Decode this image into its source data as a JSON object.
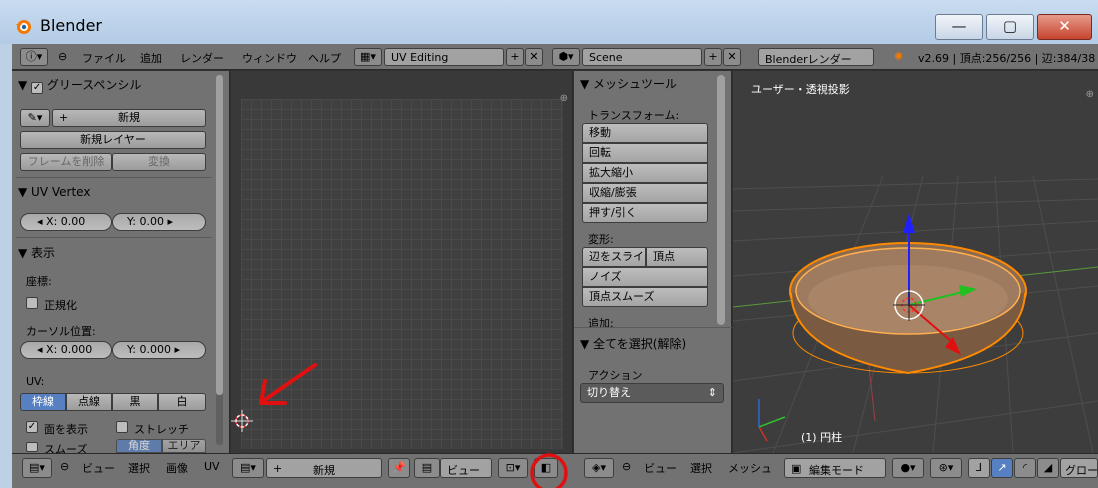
{
  "window": {
    "title": "Blender",
    "min": "—",
    "max": "▢",
    "close": "✕"
  },
  "topbar": {
    "menus": [
      "ファイル",
      "追加",
      "レンダー",
      "ウィンドウ",
      "ヘルプ"
    ],
    "layout": "UV Editing",
    "scene": "Scene",
    "engine": "Blenderレンダー",
    "stats": "v2.69 | 頂点:256/256 | 辺:384/38"
  },
  "left_panel": {
    "grease_pencil": {
      "title": "グリースペンシル",
      "new": "新規",
      "new_layer": "新規レイヤー",
      "delete_frame": "フレームを削除",
      "convert": "変換"
    },
    "uv_vertex": {
      "title": "UV Vertex",
      "x": "X: 0.00",
      "y": "Y: 0.00"
    },
    "display": {
      "title": "表示",
      "coords_label": "座標:",
      "normalize": "正規化",
      "cursor_label": "カーソル位置:",
      "cursor_x": "X: 0.000",
      "cursor_y": "Y: 0.000",
      "uv_label": "UV:",
      "modes": [
        "枠線",
        "点線",
        "黒",
        "白"
      ],
      "show_faces": "面を表示",
      "stretch": "ストレッチ",
      "smooth": "スムーズ",
      "angle": "角度",
      "area": "エリア"
    }
  },
  "tool_shelf": {
    "title": "メッシュツール",
    "transform_label": "トランスフォーム:",
    "transform": [
      "移動",
      "回転",
      "拡大縮小",
      "収縮/膨張",
      "押す/引く"
    ],
    "deform_label": "変形:",
    "slide_edge": "辺をスライ",
    "vertex": "頂点",
    "noise": "ノイズ",
    "smooth_vertex": "頂点スムーズ",
    "add_label": "追加:",
    "select_all": "全てを選択(解除)",
    "action_label": "アクション",
    "toggle": "切り替え"
  },
  "viewport": {
    "label": "ユーザー・透視投影",
    "object": "(1) 円柱"
  },
  "bottombar": {
    "uv_menus": [
      "ビュー",
      "選択",
      "画像",
      "UV"
    ],
    "new": "新規",
    "view": "ビュー",
    "v3d_menus": [
      "ビュー",
      "選択",
      "メッシュ"
    ],
    "mode": "編集モード",
    "global": "グロー"
  },
  "colors": {
    "accent": "#5680c2",
    "selected": "#ff8a00",
    "annotation": "#e01010"
  }
}
